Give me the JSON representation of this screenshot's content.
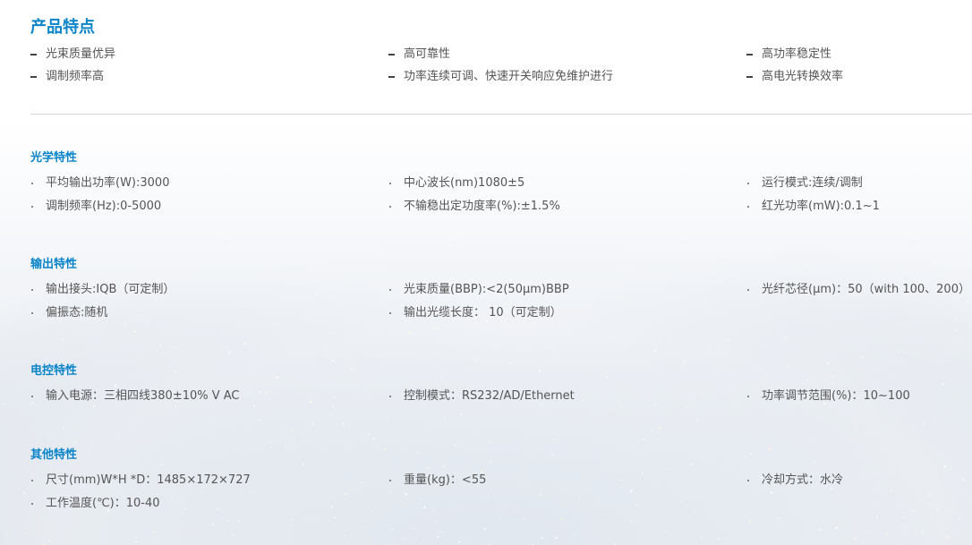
{
  "features": {
    "title": "产品特点",
    "items": [
      "光束质量优异",
      "高可靠性",
      "高功率稳定性",
      "调制频率高",
      "功率连续可调、快速开关响应免维护进行",
      "高电光转换效率"
    ]
  },
  "optical": {
    "title": "光学特性",
    "items": [
      "平均输出功率(W):3000",
      "中心波长(nm)1080±5",
      "运行模式:连续/调制",
      "调制频率(Hz):0-5000",
      "不输稳出定功度率(%):±1.5%",
      "红光功率(mW):0.1~1"
    ]
  },
  "output": {
    "title": "输出特性",
    "items": [
      "输出接头:IQB（可定制）",
      "光束质量(BBP):<2(50μm)BBP",
      "光纤芯径(μm)：50（with 100、200）",
      "偏振态:随机",
      "输出光缆长度： 10（可定制）"
    ]
  },
  "electrical": {
    "title": "电控特性",
    "items": [
      "输入电源：三相四线380±10% V AC",
      "控制模式：RS232/AD/Ethernet",
      "功率调节范围(%)：10~100"
    ]
  },
  "other": {
    "title": "其他特性",
    "items": [
      "尺寸(mm)W*H *D：1485×172×727",
      "重量(kg)：<55",
      "冷却方式：水冷",
      "工作温度(℃)：10-40"
    ]
  }
}
